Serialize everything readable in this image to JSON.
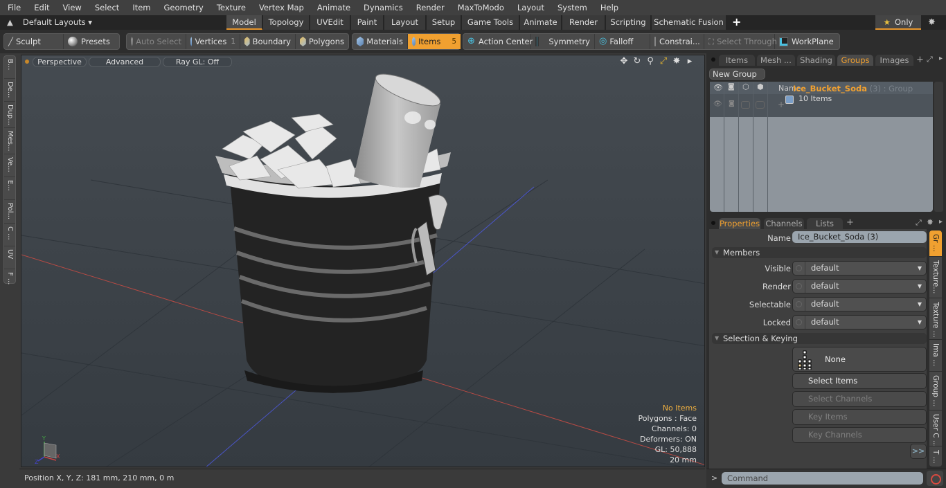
{
  "menubar": [
    "File",
    "Edit",
    "View",
    "Select",
    "Item",
    "Geometry",
    "Texture",
    "Vertex Map",
    "Animate",
    "Dynamics",
    "Render",
    "MaxToModo",
    "Layout",
    "System",
    "Help"
  ],
  "layouts": {
    "label": "Default Layouts ▾"
  },
  "layout_tabs": [
    "Model",
    "Topology",
    "UVEdit",
    "Paint",
    "Layout",
    "Setup",
    "Game Tools",
    "Animate",
    "Render",
    "Scripting",
    "Schematic Fusion"
  ],
  "active_layout_tab": "Model",
  "only_button": "Only",
  "toolbar": {
    "sculpt": "Sculpt",
    "presets": "Presets",
    "auto_select": "Auto Select",
    "vertices": "Vertices",
    "vertices_count": "1",
    "boundary": "Boundary",
    "polygons": "Polygons",
    "materials": "Materials",
    "items": "Items",
    "items_count": "5",
    "action_center": "Action Center",
    "symmetry": "Symmetry",
    "falloff": "Falloff",
    "constraints": "Constrai...",
    "select_through": "Select Through",
    "workplane": "WorkPlane"
  },
  "left_tabs": [
    "B...",
    "De...",
    "Dup...",
    "Mes...",
    "Ve...",
    "E...",
    "Pol...",
    "C ...",
    "UV",
    "F ..."
  ],
  "viewport": {
    "perspective": "Perspective",
    "advanced": "Advanced",
    "raygl": "Ray GL: Off",
    "hud": {
      "selection": "No Items",
      "polygons": "Polygons : Face",
      "channels": "Channels: 0",
      "deformers": "Deformers: ON",
      "gl": "GL: 50,888",
      "scale": "20 mm"
    }
  },
  "status": {
    "position": "Position X, Y, Z:   181 mm, 210 mm, 0 m"
  },
  "right_tabs": [
    "Items",
    "Mesh ...",
    "Shading",
    "Groups",
    "Images"
  ],
  "active_right_tab": "Groups",
  "groups": {
    "new_group": "New Group",
    "name_header": "Name",
    "row": {
      "name": "Ice_Bucket_Soda",
      "suffix": " (3) : Group",
      "items": "10 Items"
    }
  },
  "props_tabs": [
    "Properties",
    "Channels",
    "Lists"
  ],
  "properties": {
    "name_label": "Name",
    "name_value": "Ice_Bucket_Soda (3)",
    "members_section": "Members",
    "fields": [
      {
        "label": "Visible",
        "value": "default"
      },
      {
        "label": "Render",
        "value": "default"
      },
      {
        "label": "Selectable",
        "value": "default"
      },
      {
        "label": "Locked",
        "value": "default"
      }
    ],
    "keying_section": "Selection & Keying",
    "none_button": "None",
    "select_items": "Select Items",
    "select_channels": "Select Channels",
    "key_items": "Key Items",
    "key_channels": "Key Channels",
    "more": ">>"
  },
  "right_vtabs": [
    "Gr ...",
    "Texture...",
    "Texture ...",
    "Ima ...",
    "Group ...",
    "User C ...",
    "T ..."
  ],
  "command": {
    "prompt": ">",
    "placeholder": "Command"
  },
  "colors": {
    "accent": "#f0a030",
    "viewport_bg": "#3d4349",
    "list_bg": "#8e959c"
  }
}
